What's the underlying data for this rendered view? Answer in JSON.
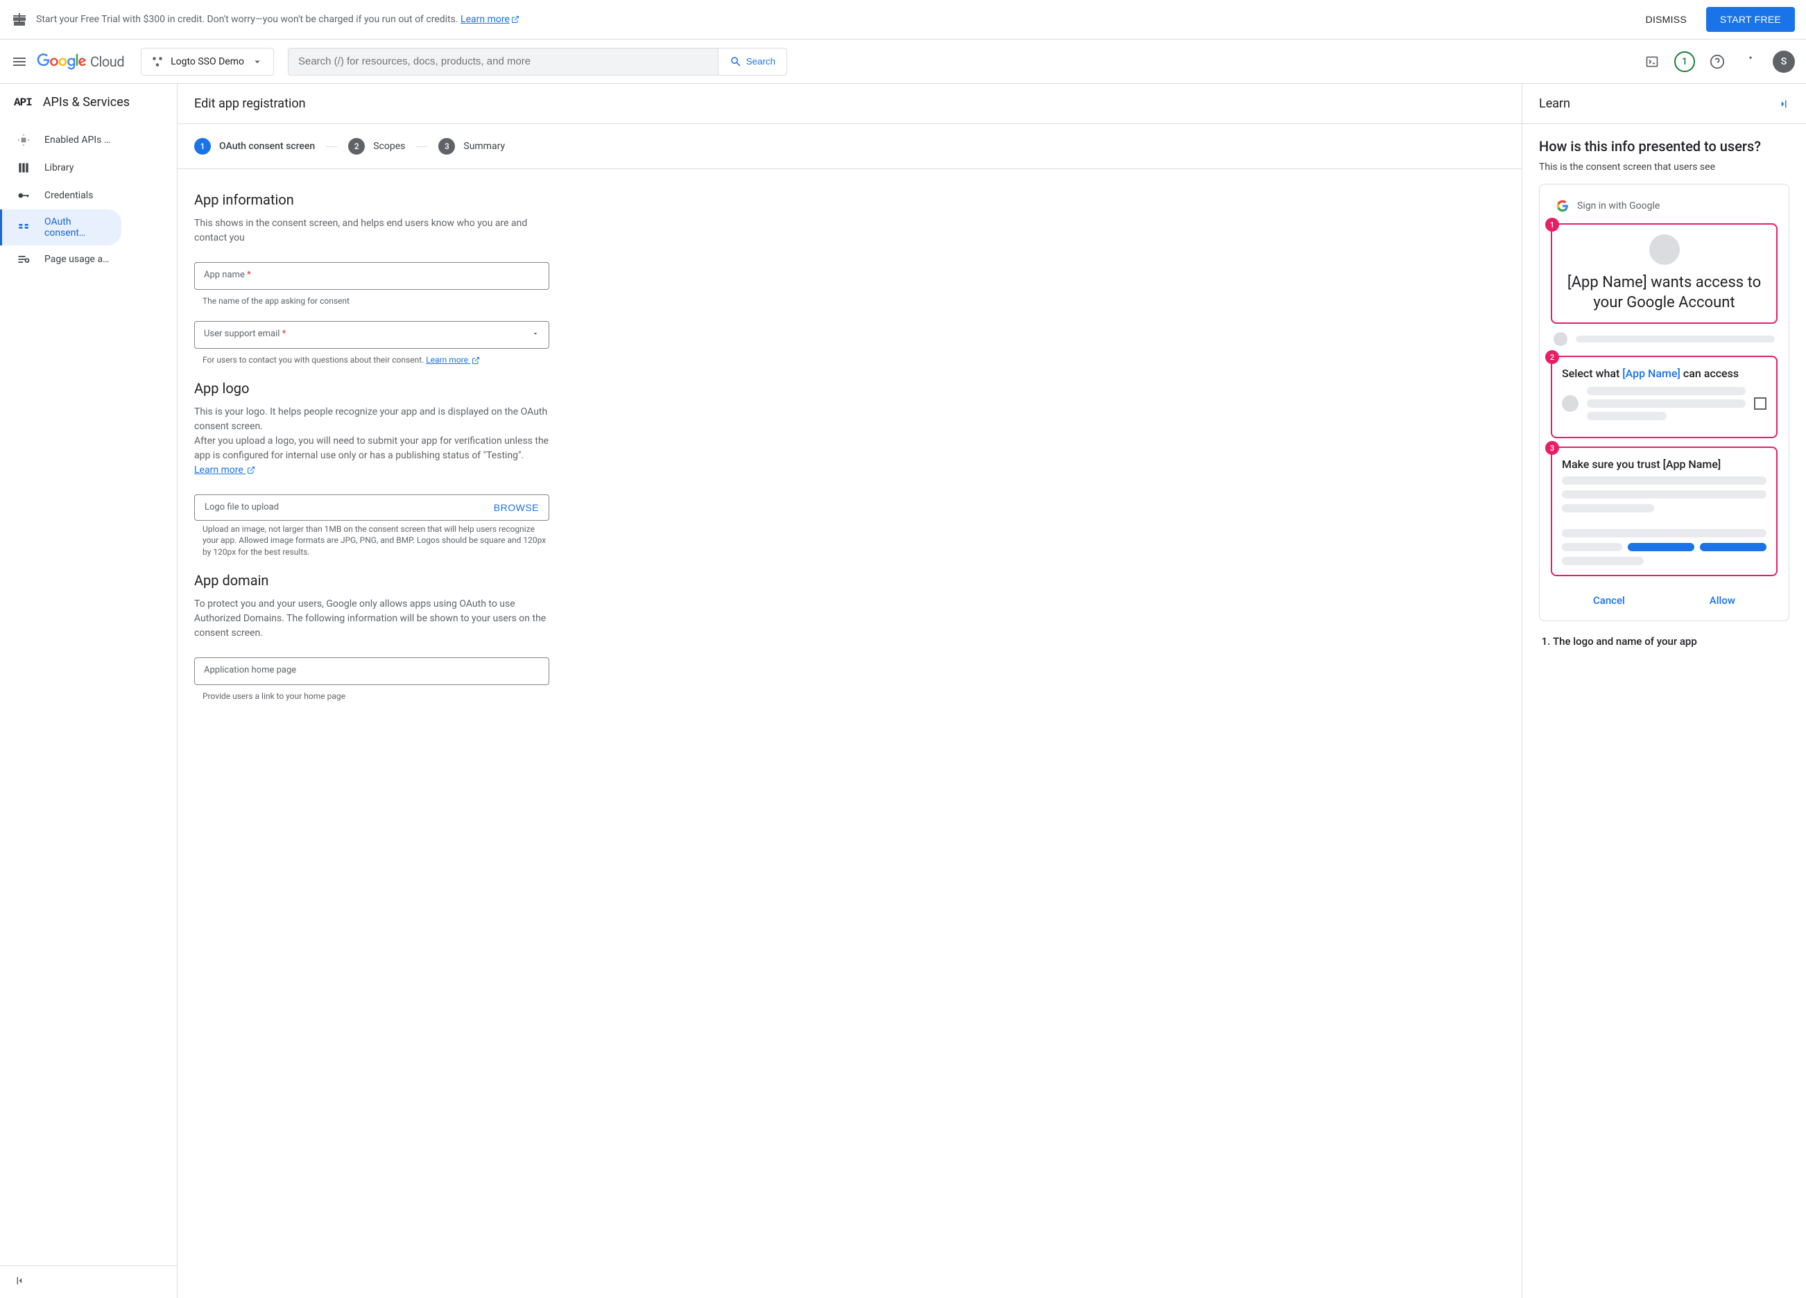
{
  "banner": {
    "text": "Start your Free Trial with $300 in credit. Don't worry—you won't be charged if you run out of credits. ",
    "learn_more": "Learn more",
    "dismiss": "DISMISS",
    "start_free": "START FREE"
  },
  "header": {
    "logo_suffix": "Cloud",
    "project": "Logto SSO Demo",
    "search_placeholder": "Search (/) for resources, docs, products, and more",
    "search_label": "Search",
    "trial_count": "1",
    "avatar_initial": "S"
  },
  "sidebar": {
    "title": "APIs & Services",
    "items": [
      {
        "label": "Enabled APIs …",
        "icon": "enabled"
      },
      {
        "label": "Library",
        "icon": "library"
      },
      {
        "label": "Credentials",
        "icon": "credentials"
      },
      {
        "label": "OAuth consent…",
        "icon": "oauth",
        "selected": true
      },
      {
        "label": "Page usage a…",
        "icon": "usage"
      }
    ]
  },
  "main": {
    "title": "Edit app registration",
    "steps": [
      {
        "num": "1",
        "label": "OAuth consent screen",
        "active": true
      },
      {
        "num": "2",
        "label": "Scopes"
      },
      {
        "num": "3",
        "label": "Summary"
      }
    ],
    "app_info": {
      "title": "App information",
      "desc": "This shows in the consent screen, and helps end users know who you are and contact you",
      "app_name_label": "App name",
      "app_name_hint": "The name of the app asking for consent",
      "support_email_label": "User support email",
      "support_email_hint": "For users to contact you with questions about their consent. ",
      "learn_more": "Learn more"
    },
    "app_logo": {
      "title": "App logo",
      "desc1": "This is your logo. It helps people recognize your app and is displayed on the OAuth consent screen.",
      "desc2": "After you upload a logo, you will need to submit your app for verification unless the app is configured for internal use only or has a publishing status of \"Testing\". ",
      "learn_more": "Learn more",
      "upload_label": "Logo file to upload",
      "browse": "BROWSE",
      "upload_hint": "Upload an image, not larger than 1MB on the consent screen that will help users recognize your app. Allowed image formats are JPG, PNG, and BMP. Logos should be square and 120px by 120px for the best results."
    },
    "app_domain": {
      "title": "App domain",
      "desc": "To protect you and your users, Google only allows apps using OAuth to use Authorized Domains. The following information will be shown to your users on the consent screen.",
      "homepage_label": "Application home page",
      "homepage_hint": "Provide users a link to your home page"
    }
  },
  "learn": {
    "header": "Learn",
    "title": "How is this info presented to users?",
    "subtitle": "This is the consent screen that users see",
    "signin_text": "Sign in with Google",
    "section1_text": "[App Name] wants access to your Google Account",
    "section2_prefix": "Select what ",
    "section2_app": "[App Name]",
    "section2_suffix": " can access",
    "section3_text": "Make sure you trust [App Name]",
    "cancel": "Cancel",
    "allow": "Allow",
    "list_item1": "The logo and name of your app"
  }
}
